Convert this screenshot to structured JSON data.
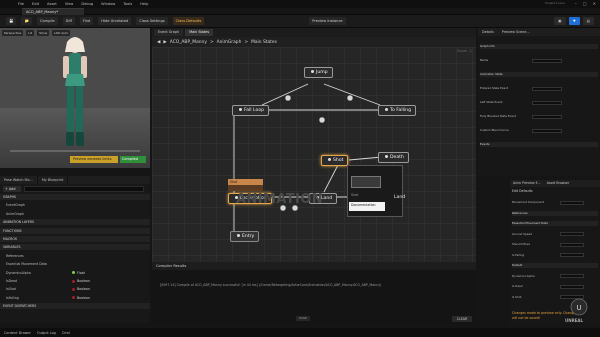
{
  "menu": [
    "File",
    "Edit",
    "Asset",
    "View",
    "Debug",
    "Window",
    "Tools",
    "Help"
  ],
  "asset_tab": "ACO_ABP_Manny*",
  "window_meta": "Project Locus",
  "toolbar": {
    "compile": "Compile",
    "diff": "Diff",
    "find": "Find",
    "hide_unrelated": "Hide Unrelated",
    "class_settings": "Class Settings",
    "class_defaults": "Class Defaults",
    "preview": "Preview Instance"
  },
  "viewport": {
    "bar_items": [
      "Perspective",
      "Lit",
      "Show",
      "LOD Auto"
    ],
    "tag_warning": "Preview exceeds limits",
    "tag_ok": "Compiled"
  },
  "left_tabs": [
    "Pose Watch Ma...",
    "My Blueprint"
  ],
  "my_blueprint": {
    "add": "+ Add",
    "rows": [
      {
        "kind": "section",
        "text": "GRAPHS"
      },
      {
        "kind": "item",
        "text": "EventGraph"
      },
      {
        "kind": "item",
        "text": "AnimGraph"
      },
      {
        "kind": "section",
        "text": "ANIMATION LAYERS"
      },
      {
        "kind": "section",
        "text": "FUNCTIONS"
      },
      {
        "kind": "section",
        "text": "MACROS"
      },
      {
        "kind": "section",
        "text": "VARIABLES"
      },
      {
        "kind": "item",
        "text": "References"
      },
      {
        "kind": "item",
        "text": "Essential Movement Data"
      },
      {
        "kind": "var",
        "text": "DynamicsAlpha",
        "type": "Float"
      },
      {
        "kind": "var",
        "text": "IsDead",
        "type": "Boolean"
      },
      {
        "kind": "var",
        "text": "IsShot",
        "type": "Boolean"
      },
      {
        "kind": "var",
        "text": "IsFalling",
        "type": "Boolean"
      },
      {
        "kind": "section",
        "text": "EVENT DISPATCHERS"
      }
    ]
  },
  "graph": {
    "tabs": [
      "Event Graph",
      "Main States"
    ],
    "breadcrumb": [
      "ACO_ABP_Manny",
      "AnimGraph",
      "Main States"
    ],
    "zoom": "Zoom -1",
    "watermark": "ANIMATION",
    "nodes": {
      "jump": "Jump",
      "fall_loop": "Fall Loop",
      "to_falling": "To Falling",
      "shot": "Shot",
      "death": "Death",
      "locomotion": "Locomotion",
      "land_a": "Land",
      "land_b": "Land",
      "entry": "Entry"
    },
    "comment": "Shot",
    "doc_title": "Documentation",
    "doc_text": "Land",
    "tooltip_label": "Shot"
  },
  "compiler": {
    "header": "Compiler Results",
    "line": "[0097.14] Compile of ACO_ABP_Manny successful! [in 44 ms] (/Game/Retargeting/ActorCore/Animation/ACO_ABP_Manny.ACO_ABP_Manny)",
    "page": "PAGE",
    "clear": "CLEAR"
  },
  "details": {
    "tabs": [
      "Details",
      "Preview Scene..."
    ],
    "rows": [
      {
        "kind": "sec",
        "text": "Graph Info"
      },
      {
        "kind": "row",
        "text": "Name",
        "box": true
      },
      {
        "kind": "sec",
        "text": "Animation State"
      },
      {
        "kind": "row",
        "text": "Entered State Event",
        "box": true
      },
      {
        "kind": "row",
        "text": "Left State Event",
        "box": true
      },
      {
        "kind": "row",
        "text": "Fully Blended State Event",
        "box": true
      },
      {
        "kind": "row",
        "text": "Custom Blend Curve",
        "box": true
      },
      {
        "kind": "sec",
        "text": "Events"
      }
    ]
  },
  "preview": {
    "tabs": [
      "Anim Preview E...",
      "Asset Browser"
    ],
    "sub": "Edit Defaults",
    "rows": [
      {
        "kind": "row",
        "text": "Movement Component"
      },
      {
        "kind": "sec",
        "text": "References"
      },
      {
        "kind": "sec",
        "text": "Essential Movement Data"
      },
      {
        "kind": "row",
        "text": "Ground Speed"
      },
      {
        "kind": "row",
        "text": "Should Move"
      },
      {
        "kind": "row",
        "text": "Is Falling"
      },
      {
        "kind": "sec",
        "text": "Default"
      },
      {
        "kind": "row",
        "text": "Dynamics Alpha"
      },
      {
        "kind": "row",
        "text": "Is Dead"
      },
      {
        "kind": "row",
        "text": "Is Shot"
      }
    ],
    "warning": "Changes made to preview only. Changes will not be saved!"
  },
  "status": [
    "Content Drawer",
    "Output Log",
    "Cmd"
  ],
  "badge": "UNREAL"
}
